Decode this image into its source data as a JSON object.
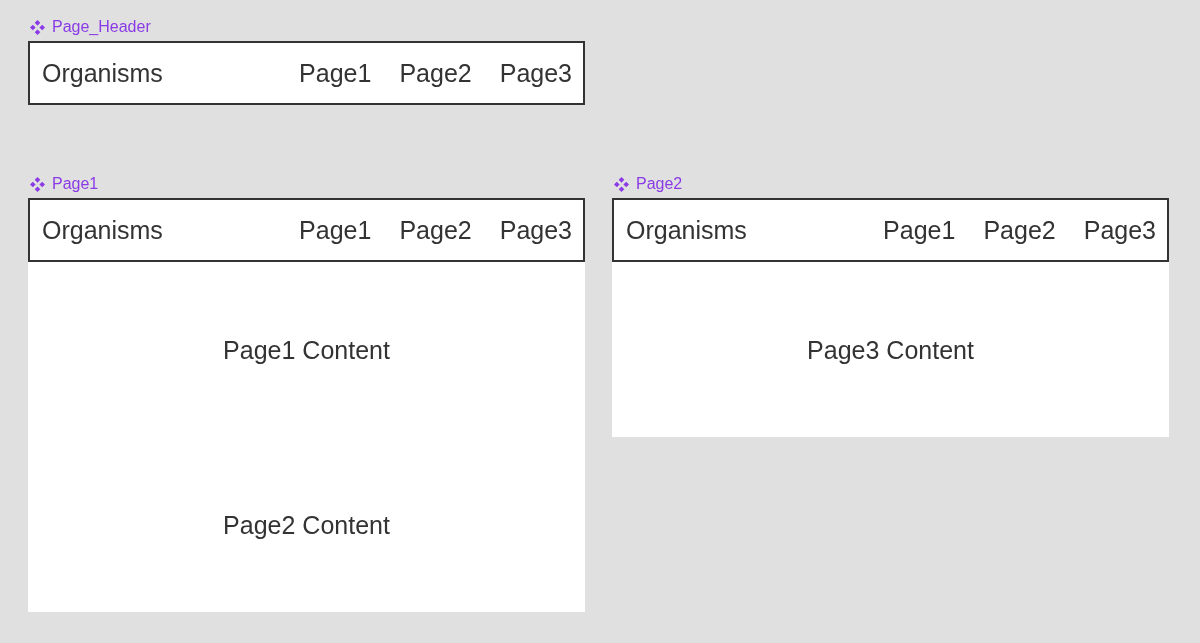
{
  "canvas": {
    "components": [
      {
        "name": "Page_Header",
        "kind": "header",
        "header": {
          "brand": "Organisms",
          "nav": [
            "Page1",
            "Page2",
            "Page3"
          ]
        }
      },
      {
        "name": "Page1",
        "kind": "page",
        "header": {
          "brand": "Organisms",
          "nav": [
            "Page1",
            "Page2",
            "Page3"
          ]
        },
        "content": [
          "Page1 Content",
          "Page2 Content"
        ]
      },
      {
        "name": "Page2",
        "kind": "page",
        "header": {
          "brand": "Organisms",
          "nav": [
            "Page1",
            "Page2",
            "Page3"
          ]
        },
        "content": [
          "Page3 Content"
        ]
      }
    ]
  }
}
